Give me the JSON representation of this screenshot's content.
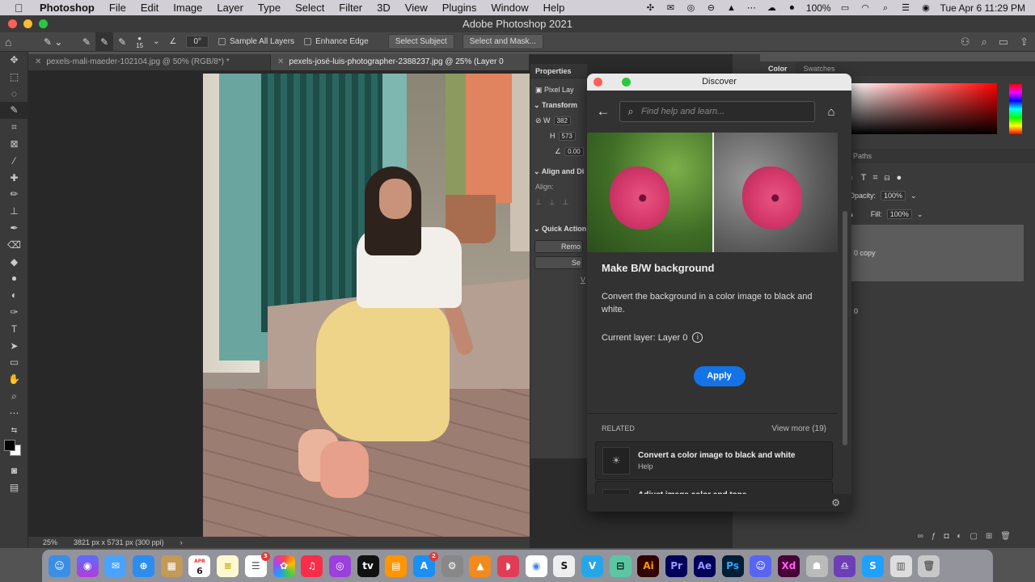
{
  "menubar": {
    "app": "Photoshop",
    "items": [
      "File",
      "Edit",
      "Image",
      "Layer",
      "Type",
      "Select",
      "Filter",
      "3D",
      "View",
      "Plugins",
      "Window",
      "Help"
    ],
    "battery": "100%",
    "datetime": "Tue Apr 6  11:29 PM"
  },
  "window": {
    "title": "Adobe Photoshop 2021"
  },
  "options": {
    "brush_size": "15",
    "angle": "0°",
    "sample_all_layers": "Sample All Layers",
    "enhance_edge": "Enhance Edge",
    "select_subject": "Select Subject",
    "select_mask": "Select and Mask..."
  },
  "tabs": [
    {
      "label": "pexels-mali-maeder-102104.jpg @ 50% (RGB/8*) *"
    },
    {
      "label": "pexels-josé-luis-photographer-2388237.jpg @ 25% (Layer 0"
    }
  ],
  "status": {
    "zoom": "25%",
    "doc": "3821 px x 5731 px (300 ppi)"
  },
  "properties": {
    "title": "Properties",
    "pixel_layer": "Pixel Lay",
    "transform": "Transform",
    "w_label": "W",
    "w_value": "382",
    "h_label": "H",
    "h_value": "573",
    "angle_value": "0.00",
    "align": "Align and Di",
    "align_label": "Align:",
    "quick_actions": "Quick Action",
    "remove_btn": "Remo",
    "select_btn": "Se",
    "view_more": "V"
  },
  "right": {
    "color_tab": "Color",
    "swatches_tab": "Swatches",
    "paths_tab": "Paths",
    "opacity_label": "Opacity:",
    "opacity_value": "100%",
    "fill_label": "Fill:",
    "fill_value": "100%",
    "layer1": "0 copy",
    "layer2": "0"
  },
  "discover": {
    "title": "Discover",
    "search_placeholder": "Find help and learn...",
    "heading": "Make B/W background",
    "description": "Convert the background in a color image to black and white.",
    "current_layer": "Current layer: Layer 0",
    "apply": "Apply",
    "related": "RELATED",
    "view_more": "View more (19)",
    "card1_title": "Convert a color image to black and white",
    "card1_sub": "Help",
    "card2_title": "Adjust image color and tone"
  },
  "dock": {
    "calendar_month": "APR",
    "calendar_day": "6",
    "badge_reminders": "3",
    "badge_appstore": "2",
    "ai": "Ai",
    "pr": "Pr",
    "ae": "Ae",
    "ps": "Ps",
    "xd": "Xd"
  },
  "colors": {
    "accent": "#1473e6",
    "panel": "#3a3a3a",
    "menubar": "#d3cfd6"
  }
}
